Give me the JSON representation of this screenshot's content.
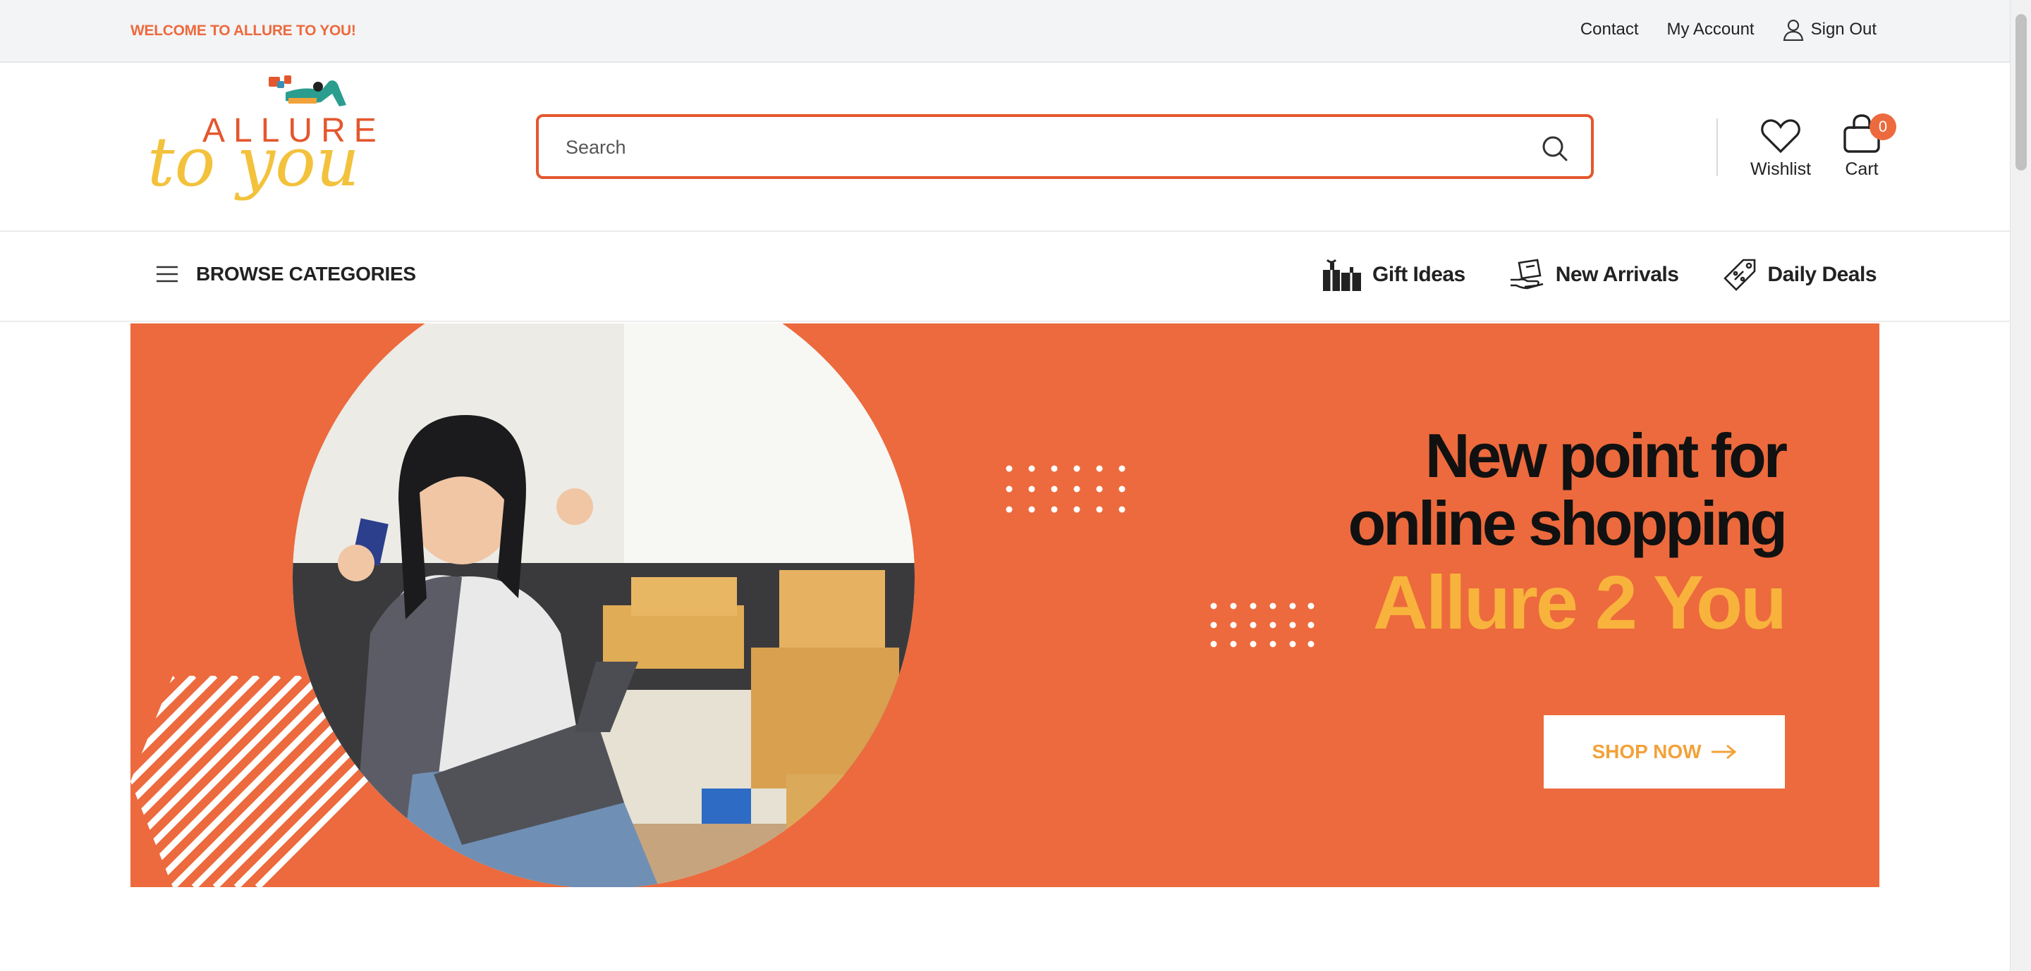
{
  "topbar": {
    "welcome": "WELCOME TO ALLURE TO YOU!",
    "contact": "Contact",
    "my_account": "My Account",
    "sign_out": "Sign Out"
  },
  "header": {
    "logo_word_top": "ALLURE",
    "logo_word_bottom": "to you",
    "search_placeholder": "Search",
    "wishlist_label": "Wishlist",
    "cart_label": "Cart",
    "cart_count": "0"
  },
  "nav": {
    "browse_label": "BROWSE CATEGORIES",
    "items": [
      {
        "label": "Gift Ideas",
        "icon": "gift-icon"
      },
      {
        "label": "New Arrivals",
        "icon": "delivery-icon"
      },
      {
        "label": "Daily Deals",
        "icon": "price-tag-icon"
      }
    ]
  },
  "hero": {
    "line1": "New point for",
    "line2": "online shopping",
    "line3": "Allure 2 You",
    "cta": "SHOP NOW",
    "image_alt": "Woman shopping online with credit card and laptop surrounded by boxes"
  },
  "colors": {
    "brand_orange": "#ec6a3d",
    "accent_yellow": "#f8b33c",
    "search_border": "#e4572e"
  }
}
